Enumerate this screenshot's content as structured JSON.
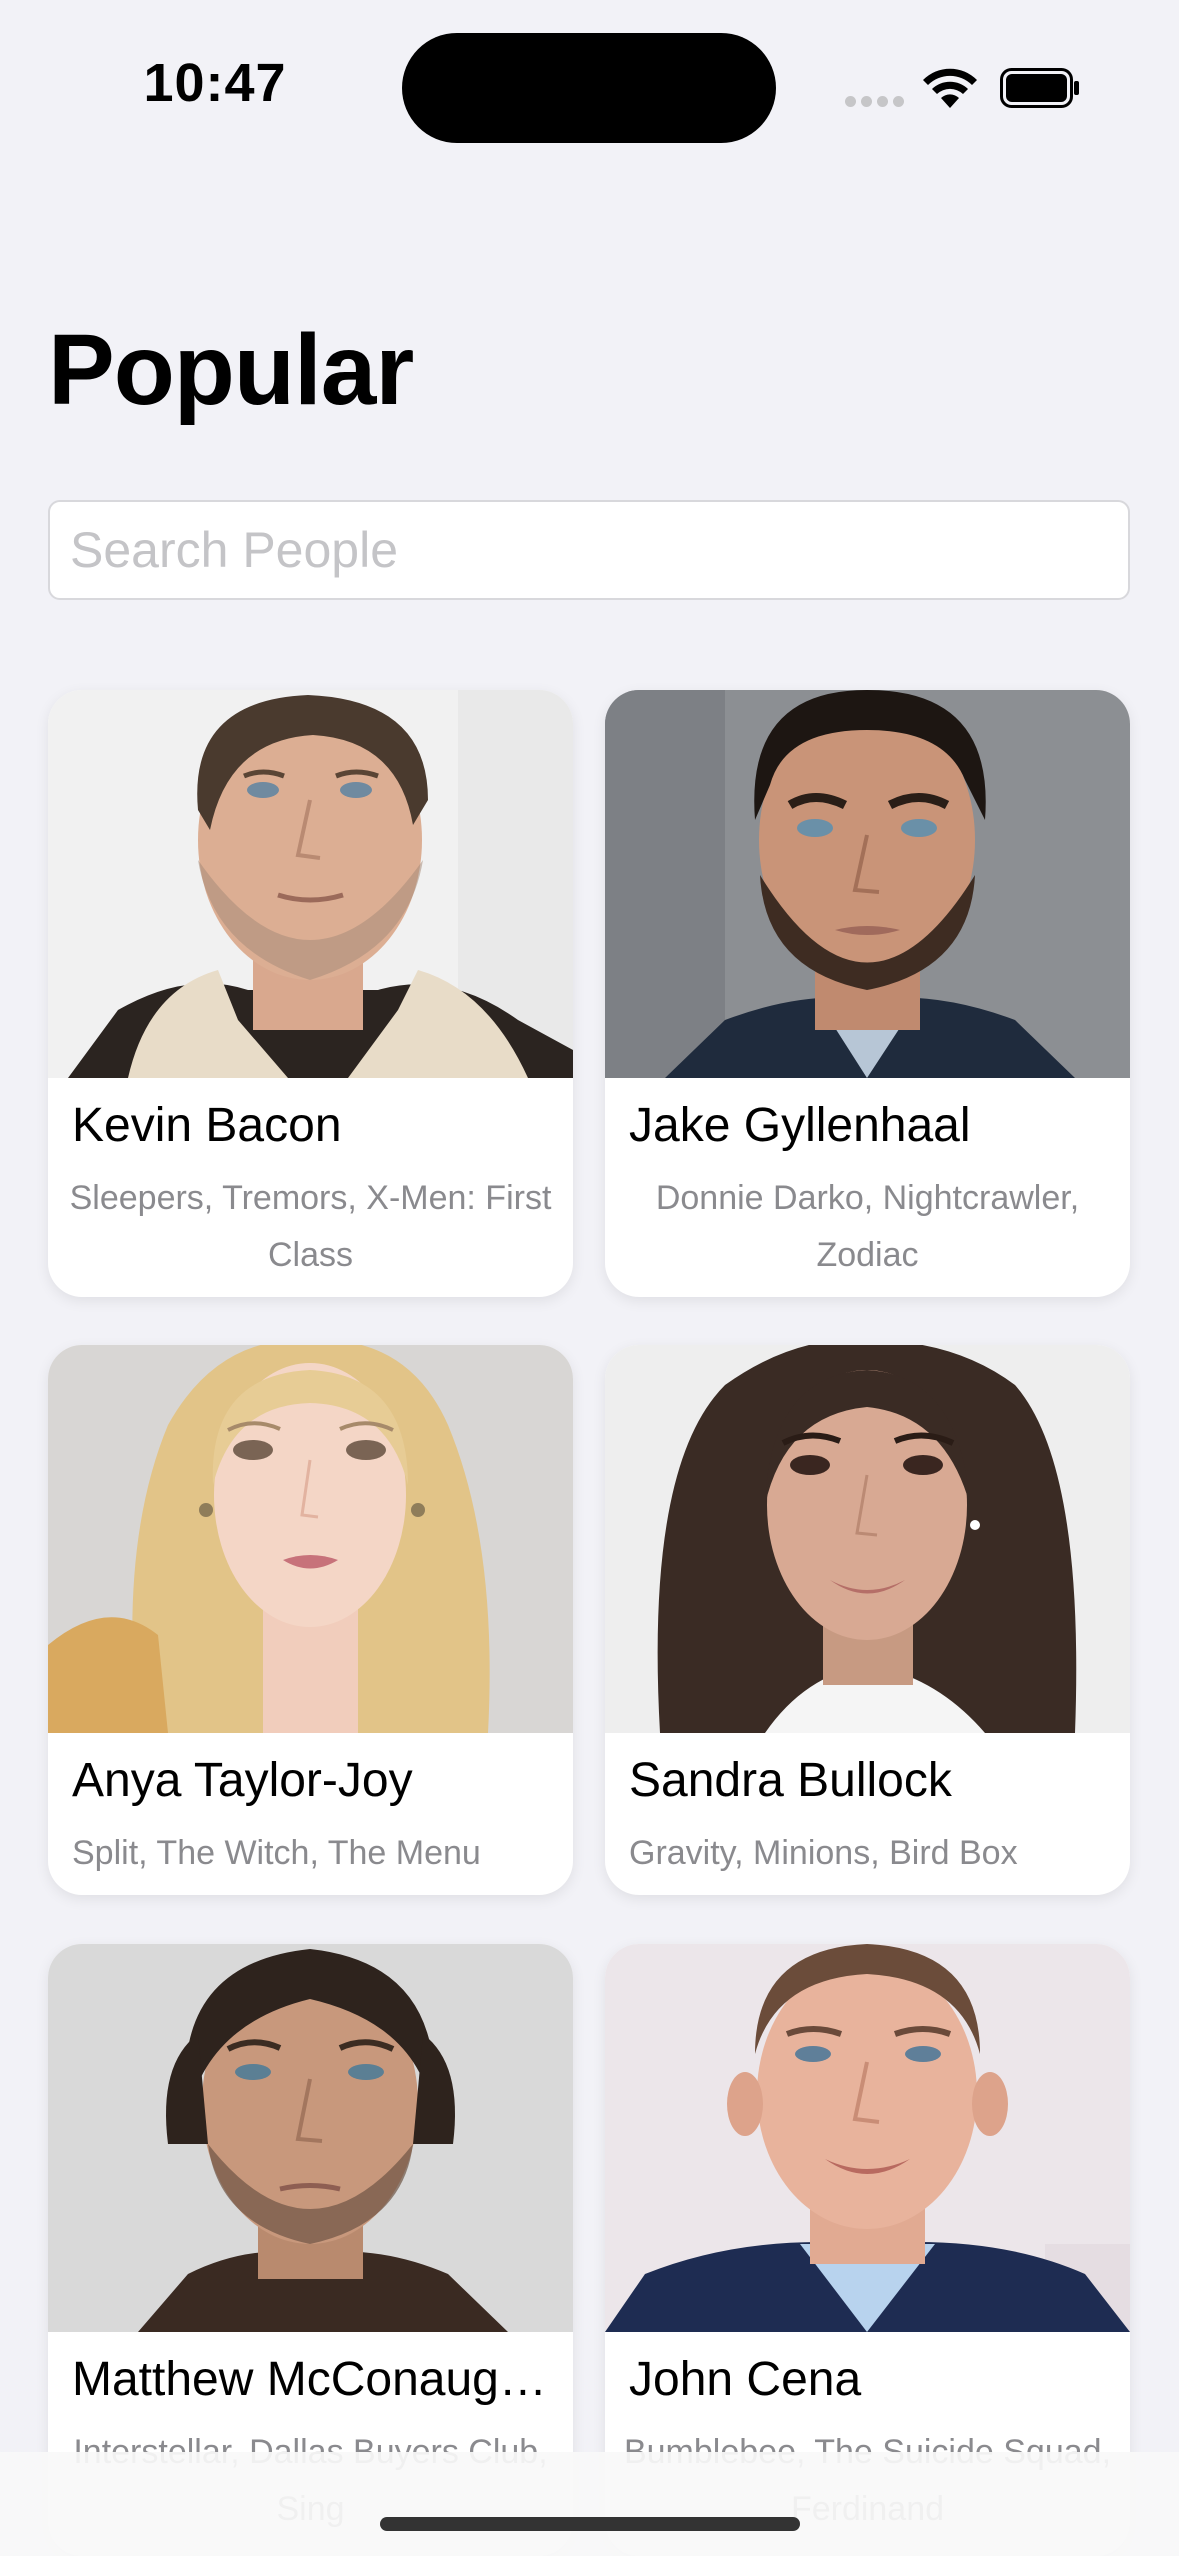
{
  "status_bar": {
    "time": "10:47"
  },
  "page": {
    "title": "Popular"
  },
  "search": {
    "placeholder": "Search People",
    "value": ""
  },
  "people": [
    {
      "name": "Kevin Bacon",
      "known_for": "Sleepers, Tremors, X-Men: First Class"
    },
    {
      "name": "Jake Gyllenhaal",
      "known_for": "Donnie Darko, Nightcrawler, Zodiac"
    },
    {
      "name": "Anya Taylor-Joy",
      "known_for": "Split, The Witch, The Menu"
    },
    {
      "name": "Sandra Bullock",
      "known_for": "Gravity, Minions, Bird Box"
    },
    {
      "name": "Matthew McConaughey",
      "known_for": "Interstellar, Dallas Buyers Club, Sing"
    },
    {
      "name": "John Cena",
      "known_for": "Bumblebee, The Suicide Squad, Ferdinand"
    }
  ]
}
